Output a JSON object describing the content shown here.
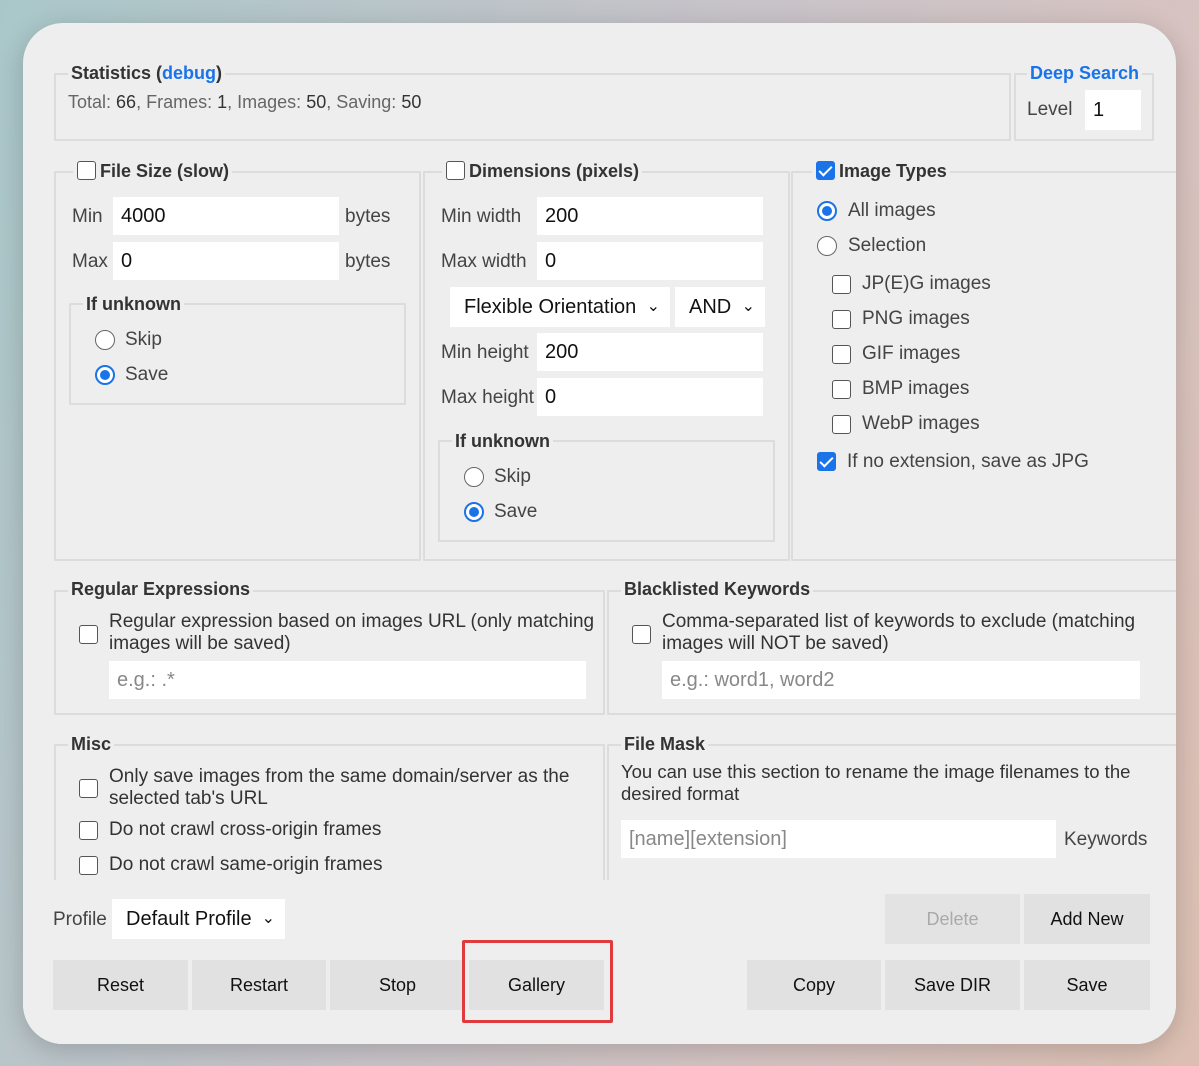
{
  "statistics": {
    "title": "Statistics",
    "debug_link": "debug",
    "total_label": "Total:",
    "total_value": "66",
    "frames_label": "Frames:",
    "frames_value": "1",
    "images_label": "Images:",
    "images_value": "50",
    "saving_label": "Saving:",
    "saving_value": "50"
  },
  "deep_search": {
    "title": "Deep Search",
    "level_label": "Level",
    "level_value": "1"
  },
  "file_size": {
    "title": "File Size (slow)",
    "enabled": false,
    "min_label": "Min",
    "min_value": "4000",
    "min_unit": "bytes",
    "max_label": "Max",
    "max_value": "0",
    "max_unit": "bytes",
    "unknown_title": "If unknown",
    "skip_label": "Skip",
    "save_label": "Save",
    "unknown_selected": "Save"
  },
  "dimensions": {
    "title": "Dimensions (pixels)",
    "enabled": false,
    "min_width_label": "Min width",
    "min_width_value": "200",
    "max_width_label": "Max width",
    "max_width_value": "0",
    "orientation_value": "Flexible Orientation",
    "operator_value": "AND",
    "min_height_label": "Min height",
    "min_height_value": "200",
    "max_height_label": "Max height",
    "max_height_value": "0",
    "unknown_title": "If unknown",
    "skip_label": "Skip",
    "save_label": "Save",
    "unknown_selected": "Save"
  },
  "image_types": {
    "title": "Image Types",
    "enabled": true,
    "all_label": "All images",
    "selection_label": "Selection",
    "selected": "All images",
    "types": [
      {
        "label": "JP(E)G images",
        "checked": false
      },
      {
        "label": "PNG images",
        "checked": false
      },
      {
        "label": "GIF images",
        "checked": false
      },
      {
        "label": "BMP images",
        "checked": false
      },
      {
        "label": "WebP images",
        "checked": false
      }
    ],
    "no_ext_label": "If no extension, save as JPG",
    "no_ext_checked": true
  },
  "regex": {
    "title": "Regular Expressions",
    "line1": "Regular expression based on images URL (only matching",
    "line2": "images will be saved)",
    "placeholder": "e.g.: .*"
  },
  "blacklist": {
    "title": "Blacklisted Keywords",
    "line1": "Comma-separated list of keywords to exclude (matching",
    "line2": "images will NOT be saved)",
    "placeholder": "e.g.: word1, word2"
  },
  "misc": {
    "title": "Misc",
    "same_domain_line1": "Only save images from the same domain/server as the",
    "same_domain_line2": "selected tab's URL",
    "cross_origin": "Do not crawl cross-origin frames",
    "same_origin": "Do not crawl same-origin frames"
  },
  "file_mask": {
    "title": "File Mask",
    "line1": "You can use this section to rename the image filenames to the",
    "line2": "desired format",
    "placeholder": "[name][extension]",
    "keywords_label": "Keywords"
  },
  "profile": {
    "label": "Profile",
    "value": "Default Profile",
    "delete_label": "Delete",
    "add_label": "Add New"
  },
  "buttons": {
    "reset": "Reset",
    "restart": "Restart",
    "stop": "Stop",
    "gallery": "Gallery",
    "copy": "Copy",
    "save_dir": "Save DIR",
    "save": "Save"
  },
  "colors": {
    "accent": "#1a73e8",
    "highlight": "#e0393e",
    "panel": "#eeeeee"
  }
}
